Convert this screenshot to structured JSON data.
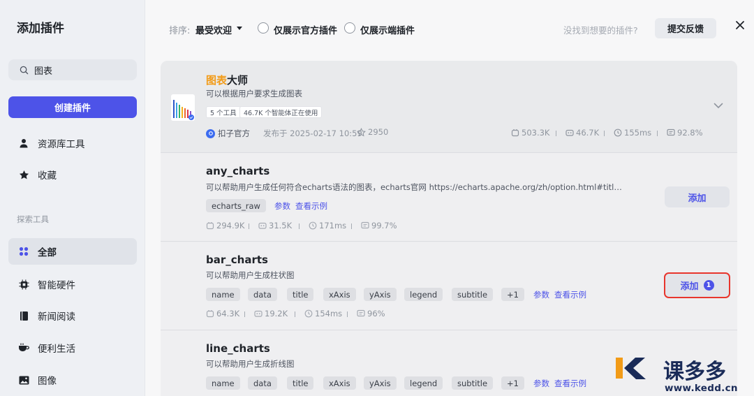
{
  "sidebar": {
    "title": "添加插件",
    "search_value": "图表",
    "create_label": "创建插件",
    "items_top": [
      {
        "label": "资源库工具",
        "icon": "user-icon"
      },
      {
        "label": "收藏",
        "icon": "star-icon"
      }
    ],
    "section_label": "探索工具",
    "items_explore": [
      {
        "label": "全部",
        "icon": "grid-icon",
        "active": true
      },
      {
        "label": "智能硬件",
        "icon": "chip-icon"
      },
      {
        "label": "新闻阅读",
        "icon": "book-icon"
      },
      {
        "label": "便利生活",
        "icon": "cup-icon"
      },
      {
        "label": "图像",
        "icon": "image-icon"
      }
    ]
  },
  "toolbar": {
    "sort_label": "排序:",
    "sort_value": "最受欢迎",
    "filter_official": "仅展示官方插件",
    "filter_client": "仅展示端插件",
    "hint": "没找到想要的插件?",
    "feedback_label": "提交反馈"
  },
  "plugins": [
    {
      "name_highlight": "图表",
      "name_rest": "大师",
      "desc": "可以根据用户要求生成图表",
      "badge_tools": "5 个工具",
      "badge_usage": "46.7K 个智能体正在使用",
      "author": "扣子官方",
      "published": "发布于 2025-02-17 10:59",
      "stars": "2950",
      "calls": "503.3K",
      "bots": "46.7K",
      "latency": "155ms",
      "success": "92.8%"
    },
    {
      "name": "any_charts",
      "desc": "可以帮助用户生成任何符合echarts语法的图表，echarts官网 https://echarts.apache.org/zh/option.html#title，不…",
      "tags": [
        "echarts_raw"
      ],
      "link_params": "参数",
      "link_example": "查看示例",
      "calls": "294.9K",
      "bots": "31.5K",
      "latency": "171ms",
      "success": "99.7%",
      "add_label": "添加"
    },
    {
      "name": "bar_charts",
      "desc": "可以帮助用户生成柱状图",
      "tags": [
        "name",
        "data",
        "title",
        "xAxis",
        "yAxis",
        "legend",
        "subtitle",
        "+1"
      ],
      "link_params": "参数",
      "link_example": "查看示例",
      "calls": "64.3K",
      "bots": "19.2K",
      "latency": "154ms",
      "success": "96%",
      "add_label": "添加",
      "added_count": "1"
    },
    {
      "name": "line_charts",
      "desc": "可以帮助用户生成折线图",
      "tags": [
        "name",
        "data",
        "title",
        "xAxis",
        "yAxis",
        "legend",
        "subtitle",
        "+1"
      ],
      "link_params": "参数",
      "link_example": "查看示例"
    }
  ],
  "watermark": {
    "brand": "课多多",
    "url": "www.kedd.cn"
  }
}
